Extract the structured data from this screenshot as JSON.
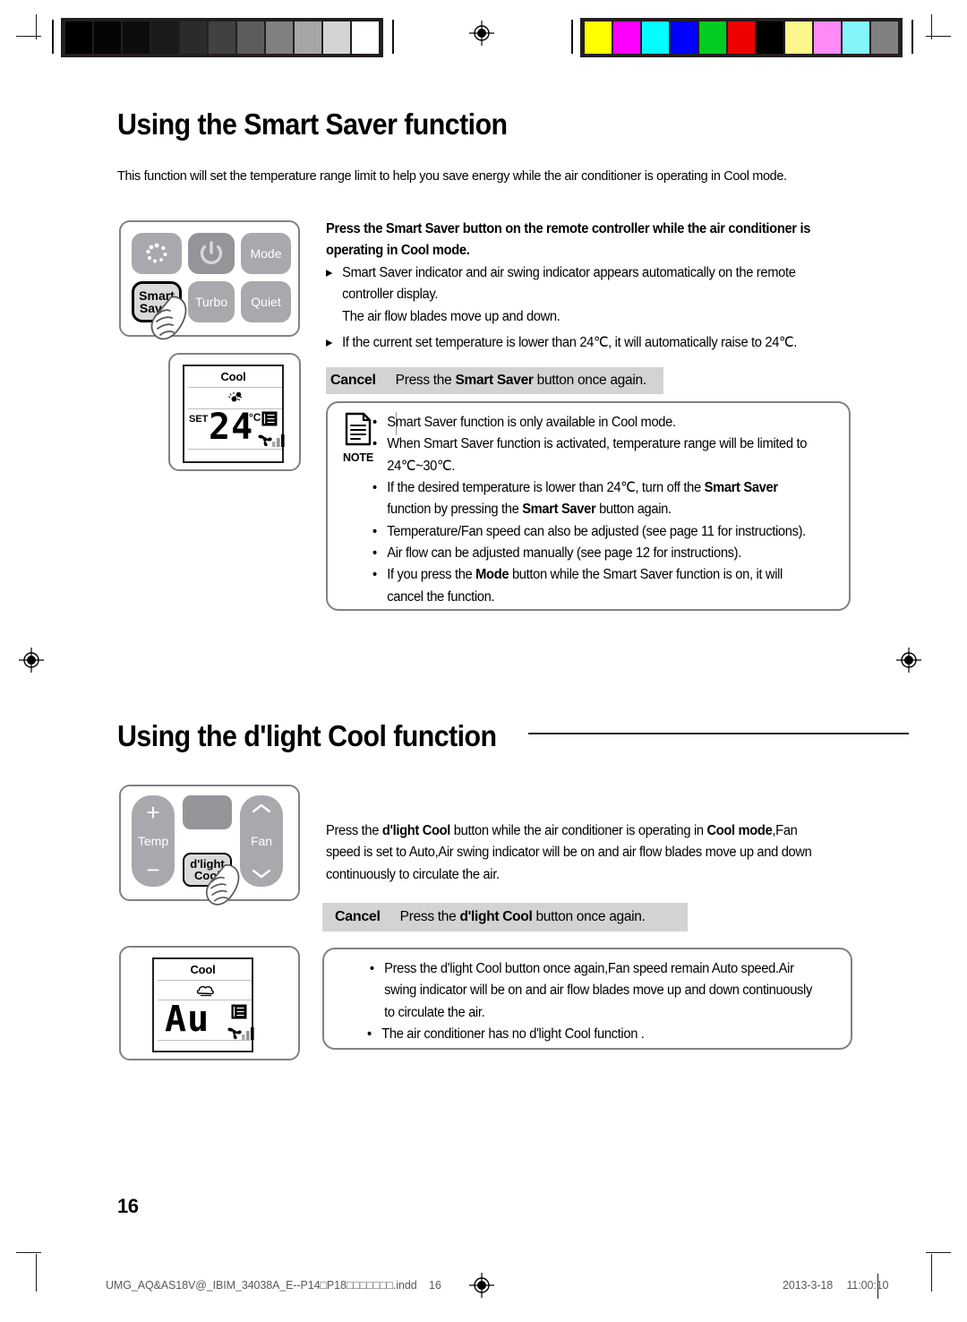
{
  "document": {
    "page_number": "16",
    "footer_filename": "UMG_AQ&AS18V@_IBIM_34038A_E--P14□P18□□□□□□□.indd",
    "footer_page": "16",
    "footer_date": "2013-3-18",
    "footer_time": "11:00:10"
  },
  "calibration": {
    "grayscale": [
      "#000000",
      "#050505",
      "#0d0d0d",
      "#1a1a1a",
      "#2b2b2b",
      "#414141",
      "#5c5c5c",
      "#808080",
      "#a6a6a6",
      "#d4d4d4",
      "#ffffff"
    ],
    "colors": [
      "#ffff00",
      "#ff00ff",
      "#00ffff",
      "#0000ff",
      "#00cc22",
      "#ee0000",
      "#000000",
      "#fdf68a",
      "#fd8bf5",
      "#83f6fb",
      "#808080"
    ]
  },
  "section1": {
    "title": "Using the Smart Saver function",
    "intro": "This function will set the temperature range limit to help you save energy while the air conditioner is operating in Cool mode.",
    "remote": {
      "buttons": [
        {
          "name": "swirl-indicator",
          "label": ""
        },
        {
          "name": "power",
          "label": ""
        },
        {
          "name": "mode",
          "label": "Mode"
        },
        {
          "name": "smart-saver",
          "label": "Smart\nSaver"
        },
        {
          "name": "turbo",
          "label": "Turbo"
        },
        {
          "name": "quiet",
          "label": "Quiet"
        }
      ]
    },
    "lcd": {
      "mode": "Cool",
      "set_label": "SET",
      "value": "24",
      "unit": "°C"
    },
    "instruction_bold": "Press the Smart Saver button on the remote controller while the air conditioner is operating in Cool mode.",
    "arrow_bullets": [
      "Smart Saver indicator and air swing indicator appears automatically on the remote controller display.\nThe air flow blades move up and down.",
      "If the current set temperature is lower than 24℃, it will automatically raise to 24℃."
    ],
    "cancel": {
      "label": "Cancel",
      "text_before": "Press the ",
      "text_bold": "Smart Saver",
      "text_after": " button once again."
    },
    "note": {
      "badge": "NOTE",
      "bullets": [
        "Smart Saver function is only available in Cool mode.",
        "When Smart Saver function is activated, temperature range will be limited to 24℃~30℃.",
        "If the desired temperature is lower than 24℃, turn off the Smart Saver function by pressing the Smart Saver button again.",
        "Temperature/Fan speed can also be adjusted (see page 11 for instructions).",
        "Air flow can be adjusted manually (see page 12 for instructions).",
        "If you press the Mode button while the Smart Saver function is on, it will cancel the function."
      ]
    }
  },
  "section2": {
    "title": "Using the d'light Cool function",
    "remote": {
      "buttons": [
        {
          "name": "temp-up",
          "label": "+"
        },
        {
          "name": "temp-label",
          "label": "Temp"
        },
        {
          "name": "temp-down",
          "label": "−"
        },
        {
          "name": "blank-top",
          "label": ""
        },
        {
          "name": "dlight-cool",
          "label": "d'light\nCool"
        },
        {
          "name": "fan-up",
          "label": ""
        },
        {
          "name": "fan-label",
          "label": "Fan"
        },
        {
          "name": "fan-down",
          "label": ""
        }
      ]
    },
    "lcd": {
      "mode": "Cool",
      "value": "Au"
    },
    "body": "Press the d'light Cool button while the air conditioner is operating in Cool mode,Fan speed is set to Auto,Air swing indicator will be on and air flow blades move up and down continuously to circulate the air.",
    "cancel": {
      "label": "Cancel",
      "text_before": "Press the ",
      "text_bold": "d'light Cool",
      "text_after": " button once again."
    },
    "note": {
      "bullets": [
        "Press the d'light Cool button once again,Fan speed remain Auto speed.Air swing indicator will be on and air flow blades move up and down continuously to circulate the air.",
        "The air conditioner has no d'light Cool function ."
      ]
    }
  }
}
